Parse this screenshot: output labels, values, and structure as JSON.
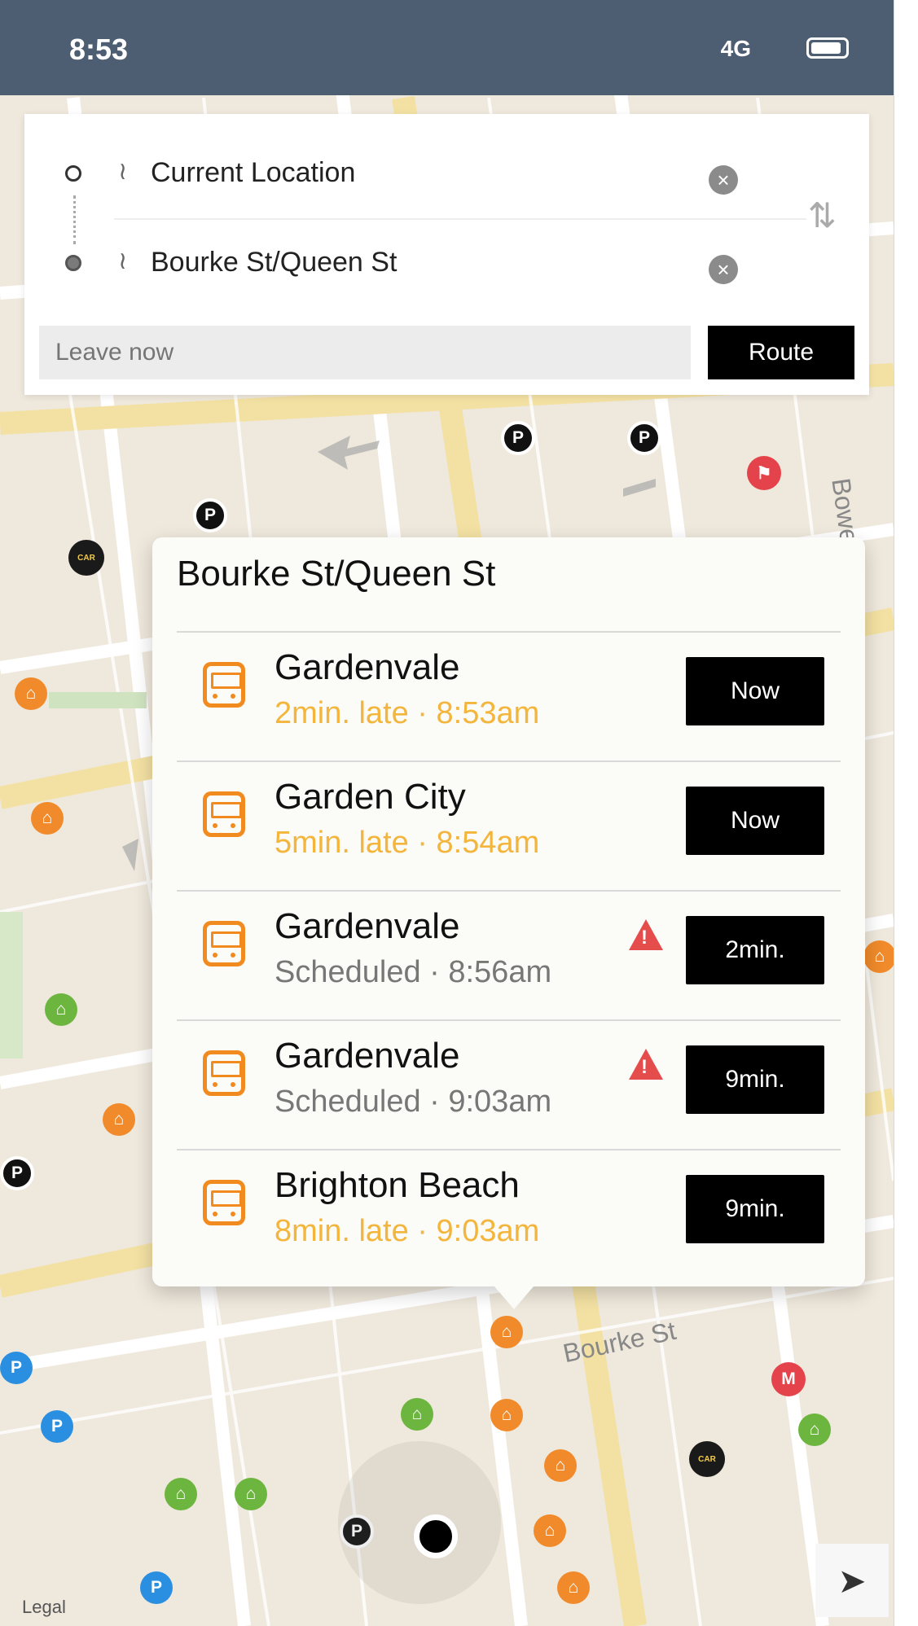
{
  "status": {
    "time": "8:53",
    "signal": "4G",
    "location_icon": "location-arrow-icon"
  },
  "search": {
    "origin": "Current Location",
    "destination": "Bourke St/Queen St",
    "leave_placeholder": "Leave now",
    "route_label": "Route"
  },
  "stop": {
    "title": "Bourke St/Queen St",
    "departures": [
      {
        "name": "Gardenvale",
        "info": "2min. late · 8:53am",
        "status": "late",
        "button": "Now",
        "warning": false
      },
      {
        "name": "Garden City",
        "info": "5min. late · 8:54am",
        "status": "late",
        "button": "Now",
        "warning": false
      },
      {
        "name": "Gardenvale",
        "info": "Scheduled · 8:56am",
        "status": "scheduled",
        "button": "2min.",
        "warning": true
      },
      {
        "name": "Gardenvale",
        "info": "Scheduled · 9:03am",
        "status": "scheduled",
        "button": "9min.",
        "warning": true
      },
      {
        "name": "Brighton Beach",
        "info": "8min. late · 9:03am",
        "status": "late",
        "button": "9min.",
        "warning": false
      }
    ]
  },
  "map": {
    "street_bourke": "Bourke St",
    "street_bow": "Bowe",
    "legal": "Legal"
  },
  "colors": {
    "tram": "#f28b1f",
    "late": "#f3b53b",
    "scheduled": "#777777",
    "status_bar": "#4d5d72"
  },
  "icons": {
    "parking": "P",
    "carpark": "CAR PARK"
  }
}
